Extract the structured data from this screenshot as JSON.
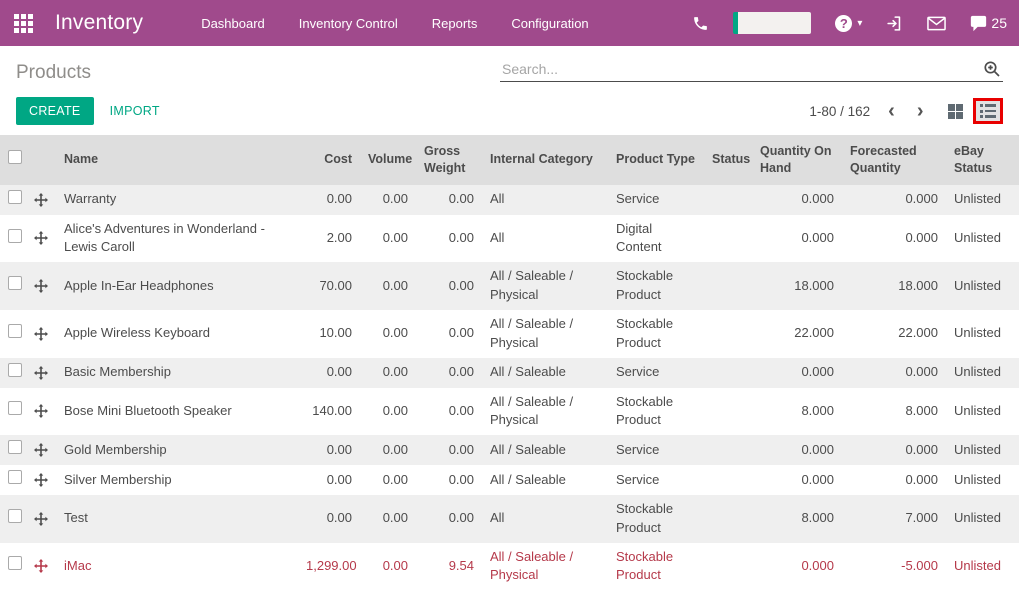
{
  "colors": {
    "topbar": "#a04a8c",
    "accent": "#00a784",
    "danger": "#b5394a",
    "highlight": "#e8randomness0000"
  },
  "topbar": {
    "app_title": "Inventory",
    "menus": [
      "Dashboard",
      "Inventory Control",
      "Reports",
      "Configuration"
    ],
    "help_glyph": "?",
    "caret": "▾",
    "messages_count": "25"
  },
  "control_panel": {
    "page_title": "Products",
    "search_placeholder": "Search...",
    "create_label": "CREATE",
    "import_label": "IMPORT",
    "pager_text": "1-80 / 162",
    "prev_glyph": "‹",
    "next_glyph": "›"
  },
  "table": {
    "headers": [
      "Name",
      "Cost",
      "Volume",
      "Gross Weight",
      "Internal Category",
      "Product Type",
      "Status",
      "Quantity On Hand",
      "Forecasted Quantity",
      "eBay Status"
    ],
    "rows": [
      {
        "name": "Warranty",
        "cost": "0.00",
        "volume": "0.00",
        "gross_weight": "0.00",
        "internal_category": "All",
        "product_type": "Service",
        "status": "",
        "qty_on_hand": "0.000",
        "forecasted_qty": "0.000",
        "ebay_status": "Unlisted",
        "danger": false
      },
      {
        "name": "Alice's Adventures in Wonderland - Lewis Caroll",
        "cost": "2.00",
        "volume": "0.00",
        "gross_weight": "0.00",
        "internal_category": "All",
        "product_type": "Digital Content",
        "status": "",
        "qty_on_hand": "0.000",
        "forecasted_qty": "0.000",
        "ebay_status": "Unlisted",
        "danger": false
      },
      {
        "name": "Apple In-Ear Headphones",
        "cost": "70.00",
        "volume": "0.00",
        "gross_weight": "0.00",
        "internal_category": "All / Saleable / Physical",
        "product_type": "Stockable Product",
        "status": "",
        "qty_on_hand": "18.000",
        "forecasted_qty": "18.000",
        "ebay_status": "Unlisted",
        "danger": false
      },
      {
        "name": "Apple Wireless Keyboard",
        "cost": "10.00",
        "volume": "0.00",
        "gross_weight": "0.00",
        "internal_category": "All / Saleable / Physical",
        "product_type": "Stockable Product",
        "status": "",
        "qty_on_hand": "22.000",
        "forecasted_qty": "22.000",
        "ebay_status": "Unlisted",
        "danger": false
      },
      {
        "name": "Basic Membership",
        "cost": "0.00",
        "volume": "0.00",
        "gross_weight": "0.00",
        "internal_category": "All / Saleable",
        "product_type": "Service",
        "status": "",
        "qty_on_hand": "0.000",
        "forecasted_qty": "0.000",
        "ebay_status": "Unlisted",
        "danger": false
      },
      {
        "name": "Bose Mini Bluetooth Speaker",
        "cost": "140.00",
        "volume": "0.00",
        "gross_weight": "0.00",
        "internal_category": "All / Saleable / Physical",
        "product_type": "Stockable Product",
        "status": "",
        "qty_on_hand": "8.000",
        "forecasted_qty": "8.000",
        "ebay_status": "Unlisted",
        "danger": false
      },
      {
        "name": "Gold Membership",
        "cost": "0.00",
        "volume": "0.00",
        "gross_weight": "0.00",
        "internal_category": "All / Saleable",
        "product_type": "Service",
        "status": "",
        "qty_on_hand": "0.000",
        "forecasted_qty": "0.000",
        "ebay_status": "Unlisted",
        "danger": false
      },
      {
        "name": "Silver Membership",
        "cost": "0.00",
        "volume": "0.00",
        "gross_weight": "0.00",
        "internal_category": "All / Saleable",
        "product_type": "Service",
        "status": "",
        "qty_on_hand": "0.000",
        "forecasted_qty": "0.000",
        "ebay_status": "Unlisted",
        "danger": false
      },
      {
        "name": "Test",
        "cost": "0.00",
        "volume": "0.00",
        "gross_weight": "0.00",
        "internal_category": "All",
        "product_type": "Stockable Product",
        "status": "",
        "qty_on_hand": "8.000",
        "forecasted_qty": "7.000",
        "ebay_status": "Unlisted",
        "danger": false
      },
      {
        "name": "iMac",
        "cost": "1,299.00",
        "volume": "0.00",
        "gross_weight": "9.54",
        "internal_category": "All / Saleable / Physical",
        "product_type": "Stockable Product",
        "status": "",
        "qty_on_hand": "0.000",
        "forecasted_qty": "-5.000",
        "ebay_status": "Unlisted",
        "danger": true
      }
    ]
  }
}
